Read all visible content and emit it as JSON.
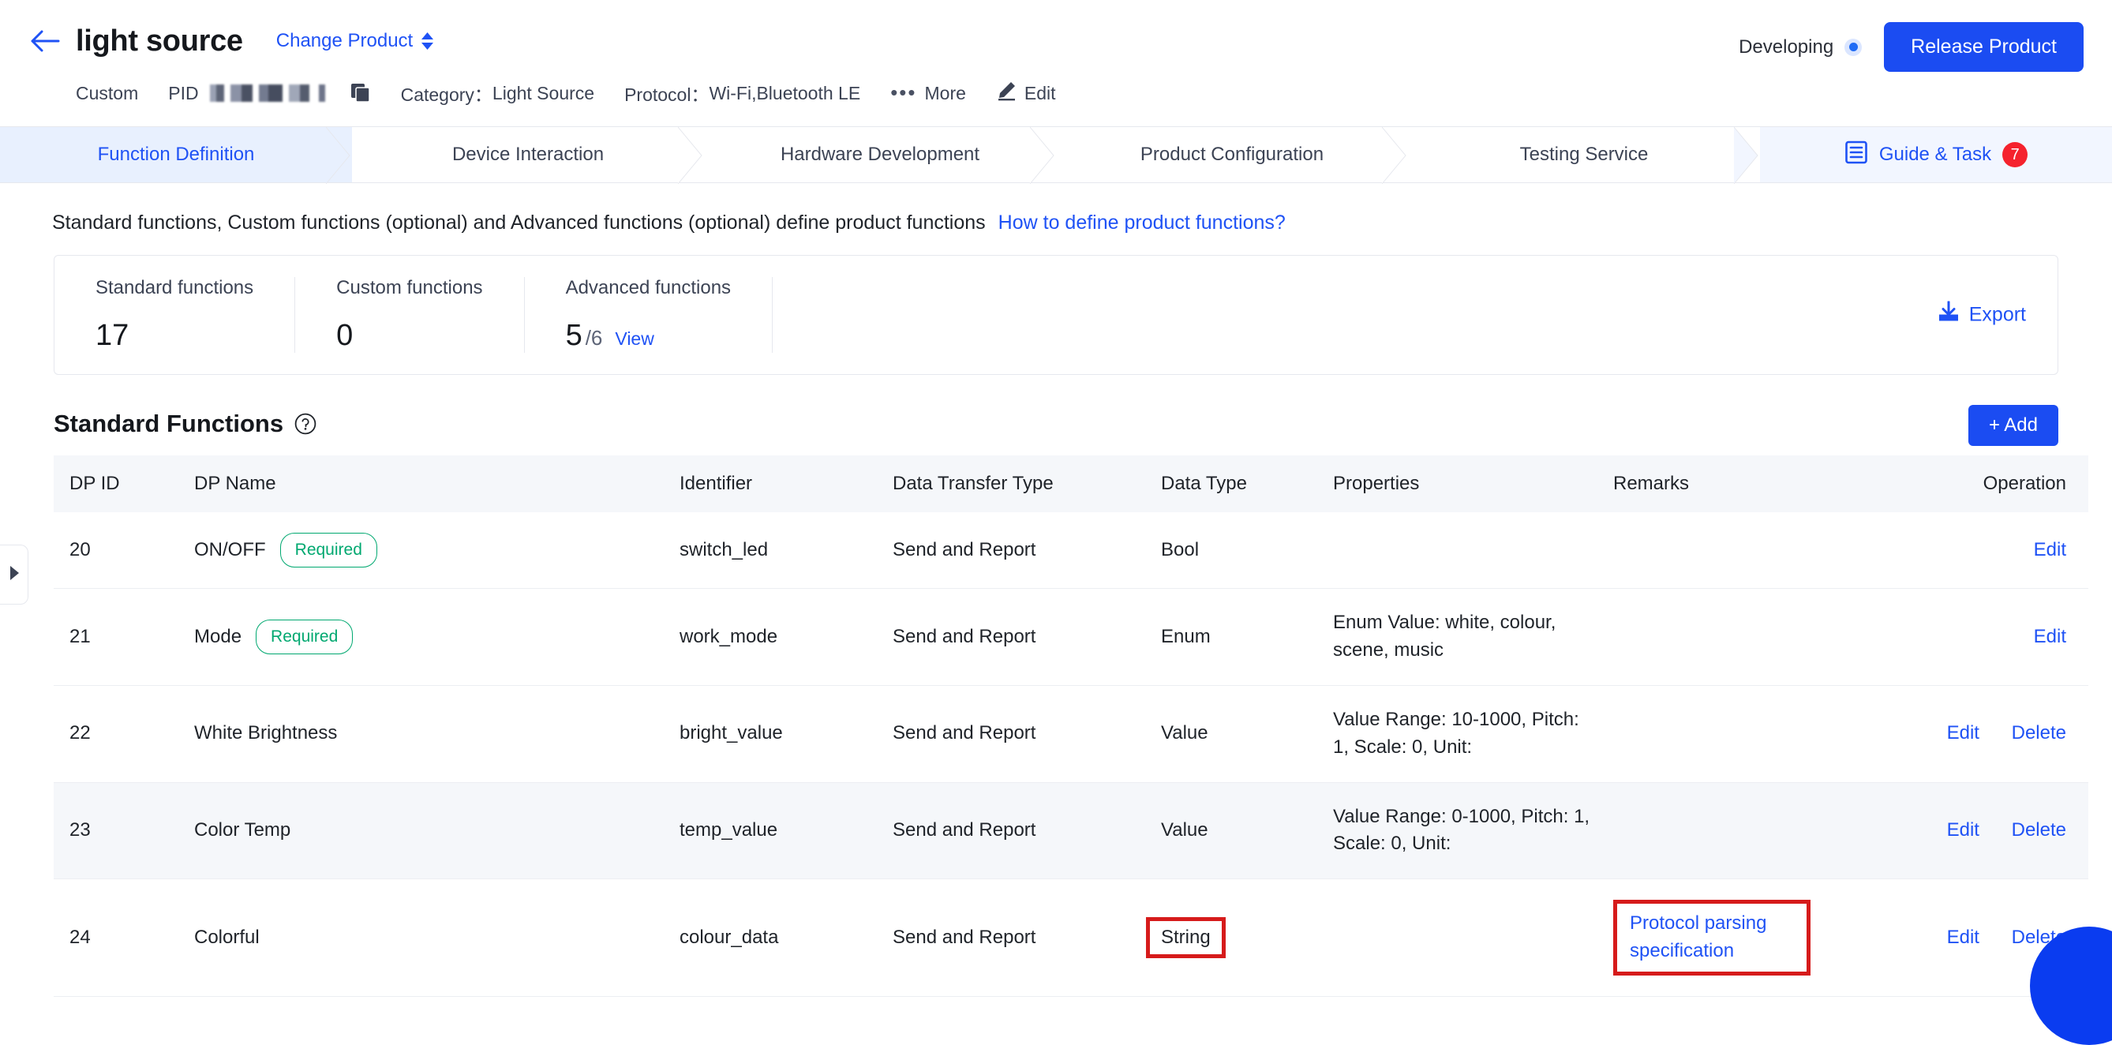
{
  "header": {
    "back_icon": "back-arrow-icon",
    "title": "light source",
    "change_product": "Change Product",
    "custom_label": "Custom",
    "pid_label": "PID",
    "pid_value": "",
    "copy_icon": "copy-icon",
    "category_label": "Category：",
    "category_value": "Light Source",
    "protocol_label": "Protocol：",
    "protocol_value": "Wi-Fi,Bluetooth LE",
    "more_label": "More",
    "edit_label": "Edit",
    "status_label": "Developing",
    "release_label": "Release Product",
    "accent_color": "#1b4cf2",
    "status_color": "#1f6bf5"
  },
  "tabs": [
    {
      "label": "Function Definition",
      "active": true
    },
    {
      "label": "Device Interaction",
      "active": false
    },
    {
      "label": "Hardware Development",
      "active": false
    },
    {
      "label": "Product Configuration",
      "active": false
    },
    {
      "label": "Testing Service",
      "active": false
    }
  ],
  "guide_tab": {
    "label": "Guide & Task",
    "badge": "7",
    "icon": "list-document-icon",
    "badge_color": "#f5222d"
  },
  "intro": {
    "text": "Standard functions, Custom functions (optional) and Advanced functions (optional) define product functions",
    "link": "How to define product functions?"
  },
  "stats": [
    {
      "label": "Standard functions",
      "value": "17",
      "sub": "",
      "view": ""
    },
    {
      "label": "Custom functions",
      "value": "0",
      "sub": "",
      "view": ""
    },
    {
      "label": "Advanced functions",
      "value": "5",
      "sub": "/6",
      "view": "View"
    }
  ],
  "export": {
    "label": "Export",
    "icon": "download-icon"
  },
  "section": {
    "title": "Standard Functions",
    "help_icon": "question-circle-icon",
    "add_label": "+ Add"
  },
  "table": {
    "columns": [
      "DP ID",
      "DP Name",
      "Identifier",
      "Data Transfer Type",
      "Data Type",
      "Properties",
      "Remarks",
      "Operation"
    ],
    "rows": [
      {
        "dp_id": "20",
        "dp_name": "ON/OFF",
        "required": "Required",
        "identifier": "switch_led",
        "transfer": "Send and Report",
        "data_type": "Bool",
        "properties": "",
        "remarks": "",
        "ops": [
          "Edit"
        ]
      },
      {
        "dp_id": "21",
        "dp_name": "Mode",
        "required": "Required",
        "identifier": "work_mode",
        "transfer": "Send and Report",
        "data_type": "Enum",
        "properties": "Enum Value: white, colour, scene, music",
        "remarks": "",
        "ops": [
          "Edit"
        ]
      },
      {
        "dp_id": "22",
        "dp_name": "White Brightness",
        "required": "",
        "identifier": "bright_value",
        "transfer": "Send and Report",
        "data_type": "Value",
        "properties": "Value Range: 10-1000, Pitch: 1, Scale: 0, Unit:",
        "remarks": "",
        "ops": [
          "Edit",
          "Delete"
        ]
      },
      {
        "dp_id": "23",
        "dp_name": "Color Temp",
        "required": "",
        "identifier": "temp_value",
        "transfer": "Send and Report",
        "data_type": "Value",
        "properties": "Value Range: 0-1000, Pitch: 1, Scale: 0, Unit:",
        "remarks": "",
        "ops": [
          "Edit",
          "Delete"
        ]
      },
      {
        "dp_id": "24",
        "dp_name": "Colorful",
        "required": "",
        "identifier": "colour_data",
        "transfer": "Send and Report",
        "data_type": "String",
        "properties": "",
        "remarks": "Protocol parsing specification",
        "ops": [
          "Edit",
          "Delete"
        ]
      }
    ]
  },
  "annotations": {
    "highlight_color": "#d61b1b",
    "highlighted": [
      "data-type-string",
      "remarks-protocol-parsing-specification"
    ]
  },
  "sidebar_handle": {
    "icon": "expand-right-triangle-icon"
  }
}
